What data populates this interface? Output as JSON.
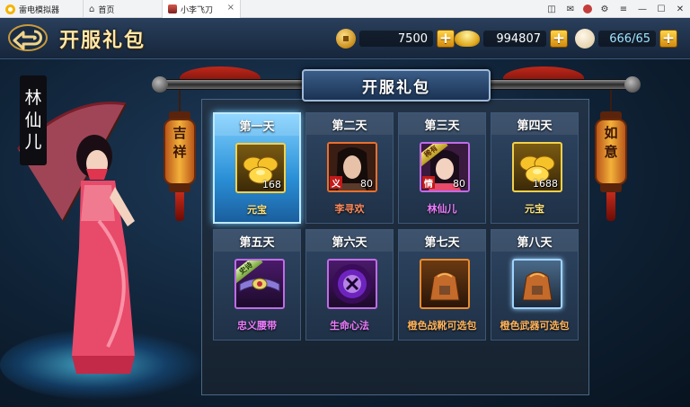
{
  "emulator": {
    "app_tab_label": "雷电模拟器",
    "home_tab_label": "首页",
    "game_tab_label": "小李飞刀",
    "tab_close": "×",
    "controls": {
      "gamepad": "◫",
      "mail": "✉",
      "settings": "⚙",
      "menu": "≡",
      "minimize": "—",
      "maximize": "☐",
      "close": "✕"
    }
  },
  "header": {
    "title": "开服礼包",
    "copper": "7500",
    "gold": "994807",
    "stamina": "666/65",
    "plus": "+"
  },
  "character": {
    "name": [
      "林",
      "仙",
      "儿"
    ]
  },
  "lanterns": {
    "left": [
      "吉",
      "祥"
    ],
    "right": [
      "如",
      "意"
    ]
  },
  "panel": {
    "title": "开服礼包",
    "days": [
      {
        "day": "第一天",
        "count": "168",
        "name": "元宝",
        "tag": "",
        "corner": ""
      },
      {
        "day": "第二天",
        "count": "80",
        "name": "李寻欢",
        "tag": "义",
        "corner": ""
      },
      {
        "day": "第三天",
        "count": "80",
        "name": "林仙儿",
        "tag": "情",
        "corner": "稀有"
      },
      {
        "day": "第四天",
        "count": "1688",
        "name": "元宝",
        "tag": "",
        "corner": ""
      },
      {
        "day": "第五天",
        "count": "",
        "name": "忠义腰带",
        "tag": "",
        "corner": "史诗"
      },
      {
        "day": "第六天",
        "count": "",
        "name": "生命心法",
        "tag": "",
        "corner": ""
      },
      {
        "day": "第七天",
        "count": "",
        "name": "橙色战靴可选包",
        "tag": "",
        "corner": ""
      },
      {
        "day": "第八天",
        "count": "",
        "name": "橙色武器可选包",
        "tag": "",
        "corner": ""
      }
    ],
    "selected_day": "第一天"
  },
  "colors": {
    "accent_blue": "#2a8fd6",
    "gold_text": "#ffe27a",
    "purple_text": "#ee7cff",
    "orange_text": "#ffb35a"
  }
}
